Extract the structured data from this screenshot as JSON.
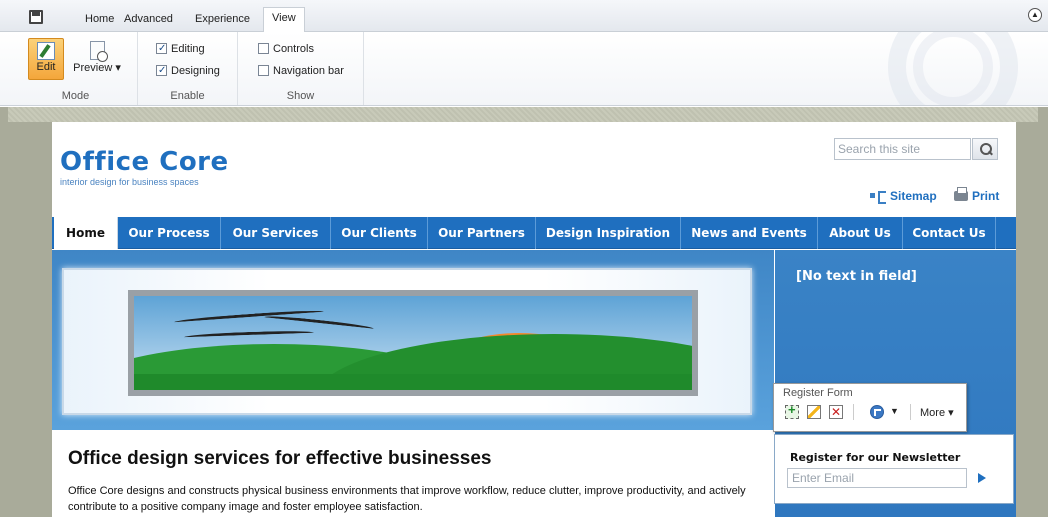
{
  "ribbon": {
    "tabs": [
      "Home",
      "Advanced",
      "Experience",
      "View"
    ],
    "active_tab": "View",
    "groups": {
      "mode": {
        "label": "Mode",
        "edit_label": "Edit",
        "preview_label": "Preview ▾"
      },
      "enable": {
        "label": "Enable",
        "items": [
          {
            "label": "Editing",
            "checked": true
          },
          {
            "label": "Designing",
            "checked": true
          }
        ]
      },
      "show": {
        "label": "Show",
        "items": [
          {
            "label": "Controls",
            "checked": false
          },
          {
            "label": "Navigation bar",
            "checked": false
          }
        ]
      }
    },
    "collapse_icon": "chevron-up-icon"
  },
  "site": {
    "logo_title": "Office Core",
    "logo_subtitle": "interior design for business spaces",
    "search_placeholder": "Search this site",
    "links": {
      "sitemap": "Sitemap",
      "print": "Print"
    },
    "nav": [
      "Home",
      "Our Process",
      "Our Services",
      "Our Clients",
      "Our Partners",
      "Design Inspiration",
      "News and Events",
      "About Us",
      "Contact Us"
    ],
    "nav_active": "Home",
    "side_panel_text": "[No text in field]",
    "floating_toolbar": {
      "label": "Register Form",
      "more_label": "More ▾"
    },
    "newsletter": {
      "title": "Register for our Newsletter",
      "placeholder": "Enter Email"
    },
    "headline": "Office design services for effective businesses",
    "body": "Office Core designs and constructs physical business environments that improve workflow, reduce clutter, improve productivity, and actively contribute to a positive company image and foster employee satisfaction."
  },
  "colors": {
    "brand_blue": "#1f6fbf",
    "edit_orange": "#f4a63b",
    "canvas_gray": "#a9ab9a"
  }
}
